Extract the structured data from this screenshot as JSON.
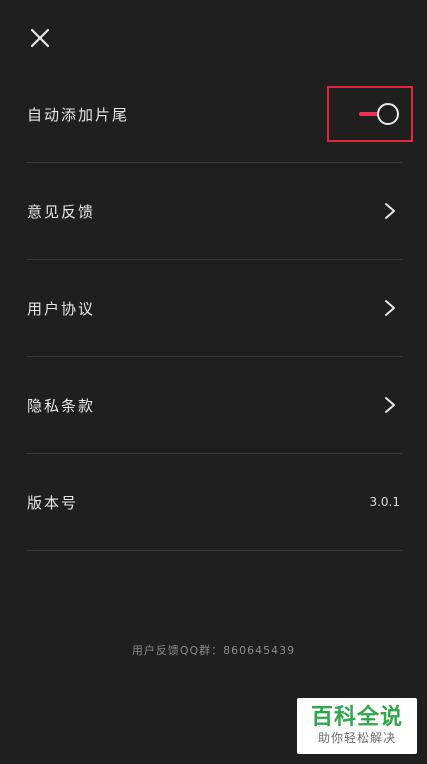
{
  "header": {
    "close_icon": "close-icon"
  },
  "settings": {
    "auto_trailer": {
      "label": "自动添加片尾",
      "enabled": true,
      "accent_color": "#f0305a",
      "highlight_color": "#e0283a"
    },
    "feedback": {
      "label": "意见反馈"
    },
    "user_agreement": {
      "label": "用户协议"
    },
    "privacy_policy": {
      "label": "隐私条款"
    },
    "version": {
      "label": "版本号",
      "value": "3.0.1"
    }
  },
  "footer": {
    "qq_group": "用户反馈QQ群：860645439"
  },
  "watermark": {
    "title": "百科全说",
    "subtitle": "助你轻松解决",
    "color": "#2ea84a"
  }
}
